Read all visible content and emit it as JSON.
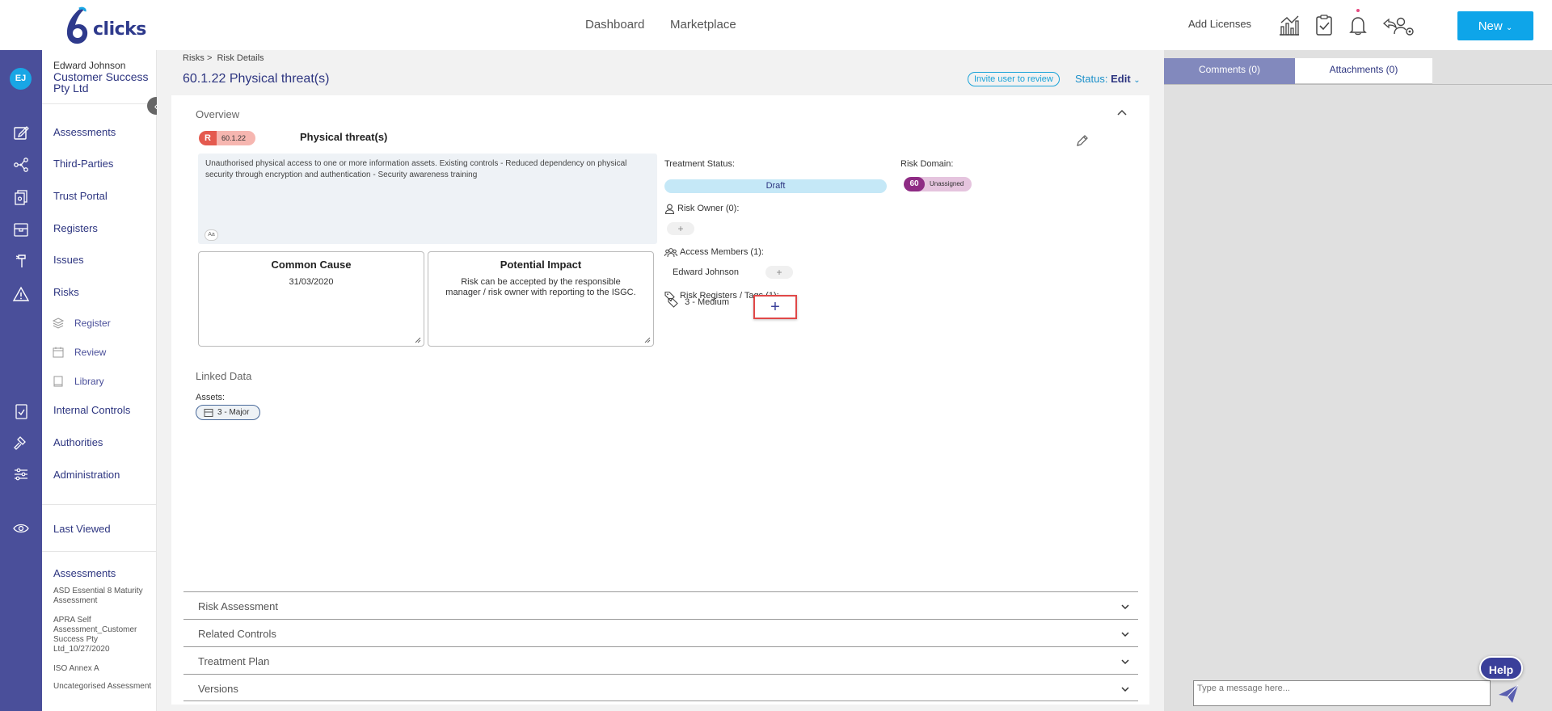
{
  "header": {
    "logo_text": "clicks",
    "nav": [
      "Dashboard",
      "Marketplace"
    ],
    "add_licenses": "Add Licenses",
    "new_button": "New",
    "icons": [
      "analytics-icon",
      "clipboard-check-icon",
      "bell-icon",
      "users-settings-icon"
    ]
  },
  "rail": {
    "avatar": "EJ"
  },
  "menu": {
    "user_name": "Edward Johnson",
    "org": "Customer Success Pty Ltd",
    "items": [
      "Assessments",
      "Third-Parties",
      "Trust Portal",
      "Registers",
      "Issues",
      "Risks"
    ],
    "risk_sub": [
      "Register",
      "Review",
      "Library"
    ],
    "items2": [
      "Internal Controls",
      "Authorities",
      "Administration"
    ],
    "last_viewed": "Last Viewed",
    "recent_title": "Assessments",
    "recent": [
      "ASD Essential 8 Maturity Assessment",
      "APRA Self Assessment_Customer Success Pty Ltd_10/27/2020",
      "ISO Annex A",
      "Uncategorised Assessment"
    ]
  },
  "page": {
    "breadcrumb": [
      "Risks",
      ">",
      "Risk Details"
    ],
    "title": "60.1.22 Physical threat(s)",
    "invite": "Invite user to review",
    "status_label": "Status:",
    "status_value": "Edit"
  },
  "overview": {
    "heading": "Overview",
    "badge_letter": "R",
    "badge_id": "60.1.22",
    "risk_name": "Physical threat(s)",
    "description": "Unauthorised physical access to one or more information assets. Existing controls - Reduced dependency on physical security through encryption and authentication - Security awareness training",
    "aa": "Aa",
    "common_cause_title": "Common Cause",
    "common_cause_value": "31/03/2020",
    "impact_title": "Potential Impact",
    "impact_value": "Risk can be accepted by the responsible manager / risk owner with reporting to the ISGC.",
    "treatment_label": "Treatment Status:",
    "treatment_value": "Draft",
    "domain_label": "Risk Domain:",
    "domain_num": "60",
    "domain_value": "Unassigned",
    "owner_label": "Risk Owner (0):",
    "access_label": "Access Members (1):",
    "member": "Edward Johnson",
    "tags_label": "Risk Registers / Tags (1):",
    "tag": "3 - Medium",
    "plus": "+",
    "linked_heading": "Linked Data",
    "assets_label": "Assets:",
    "asset": "3 - Major"
  },
  "accordions": [
    "Risk Assessment",
    "Related Controls",
    "Treatment Plan",
    "Versions"
  ],
  "right_panel": {
    "tab_comments": "Comments (0)",
    "tab_attachments": "Attachments (0)",
    "message_placeholder": "Type a message here...",
    "help": "Help"
  }
}
